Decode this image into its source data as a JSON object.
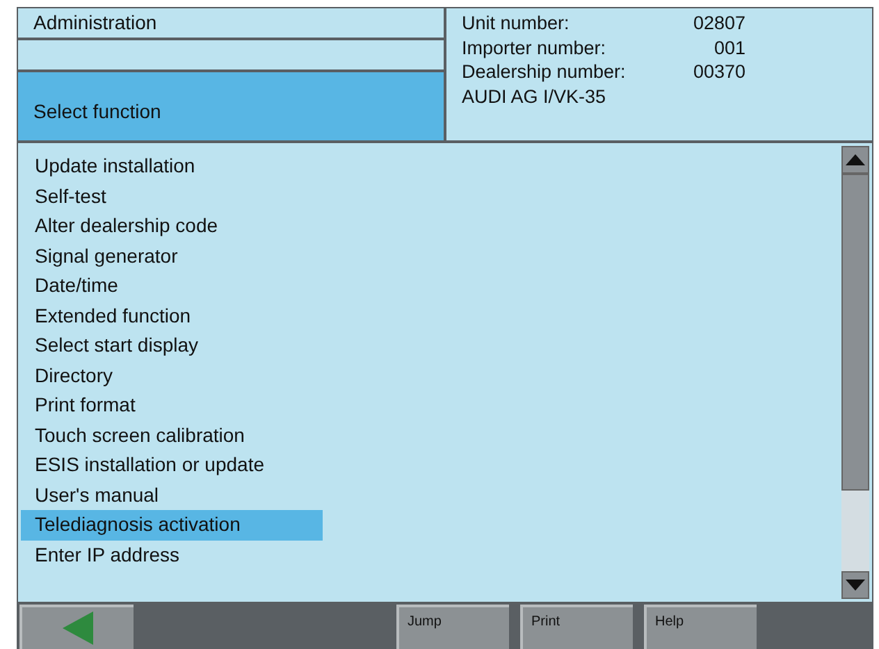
{
  "header": {
    "title": "Administration",
    "subtitle": "Select function",
    "info": [
      {
        "label": "Unit number:",
        "value": "02807"
      },
      {
        "label": "Importer number:",
        "value": "001"
      },
      {
        "label": "Dealership number:",
        "value": "00370"
      }
    ],
    "company": "AUDI AG I/VK-35"
  },
  "functions": [
    {
      "label": "Update installation",
      "selected": false
    },
    {
      "label": "Self-test",
      "selected": false
    },
    {
      "label": "Alter dealership code",
      "selected": false
    },
    {
      "label": "Signal generator",
      "selected": false
    },
    {
      "label": "Date/time",
      "selected": false
    },
    {
      "label": "Extended function",
      "selected": false
    },
    {
      "label": "Select start display",
      "selected": false
    },
    {
      "label": "Directory",
      "selected": false
    },
    {
      "label": "Print format",
      "selected": false
    },
    {
      "label": "Touch screen calibration",
      "selected": false
    },
    {
      "label": "ESIS installation or update",
      "selected": false
    },
    {
      "label": "User's manual",
      "selected": false
    },
    {
      "label": "Telediagnosis activation",
      "selected": true
    },
    {
      "label": "Enter IP address",
      "selected": false
    }
  ],
  "buttons": [
    "Jump",
    "Print",
    "Help"
  ]
}
